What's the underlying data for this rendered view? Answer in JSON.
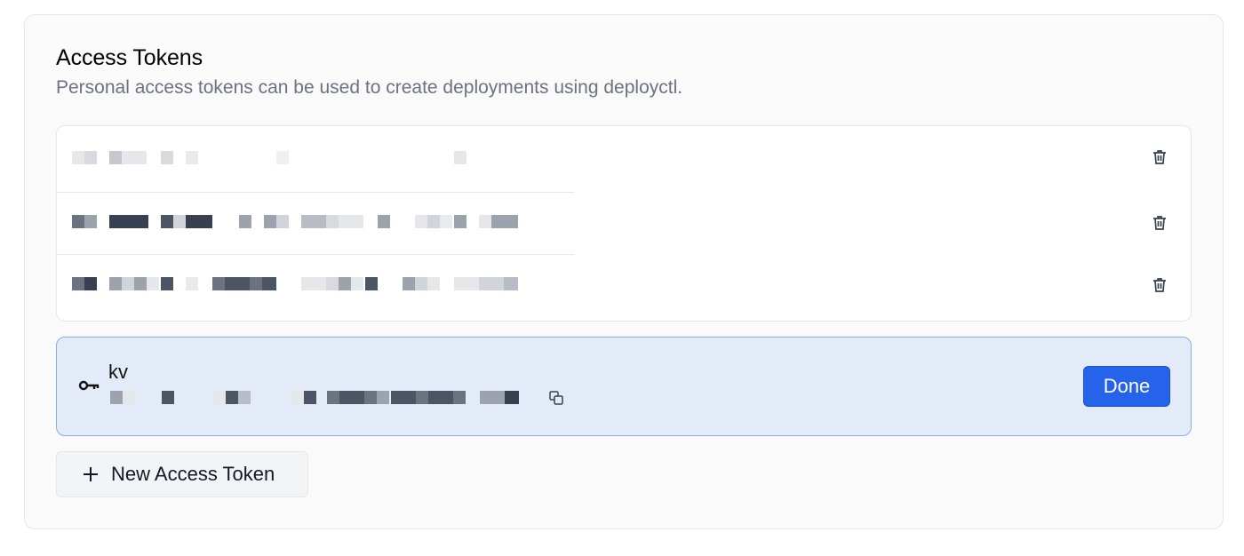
{
  "section": {
    "title": "Access Tokens",
    "subtitle": "Personal access tokens can be used to create deployments using deployctl."
  },
  "tokens": [
    {
      "label": "[redacted]",
      "delete_icon": "trash-icon"
    },
    {
      "label": "[redacted]",
      "delete_icon": "trash-icon"
    },
    {
      "label": "[redacted]",
      "delete_icon": "trash-icon"
    }
  ],
  "new_token": {
    "icon": "key-icon",
    "name": "kv",
    "secret": "[redacted]",
    "copy_icon": "copy-icon",
    "done_label": "Done"
  },
  "actions": {
    "new_token_label": "New Access Token",
    "new_token_icon": "plus-icon"
  },
  "colors": {
    "accent": "#2563eb",
    "highlight_bg": "#e4ebf8",
    "highlight_border": "#86aef0",
    "muted_text": "#6b7280"
  }
}
